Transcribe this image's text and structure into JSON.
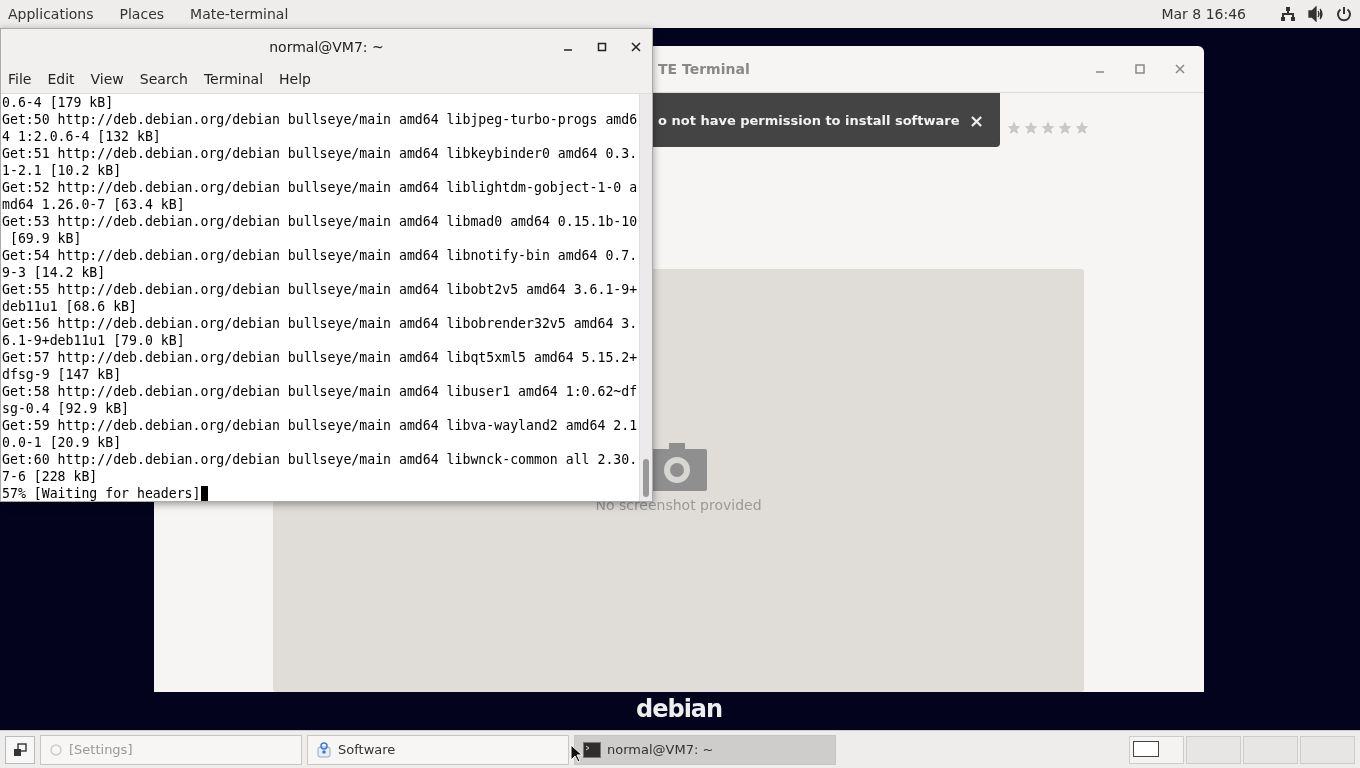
{
  "top_panel": {
    "menus": [
      "Applications",
      "Places",
      "Mate-terminal"
    ],
    "clock": "Mar 8 16:46"
  },
  "wallpaper": {
    "logo": "debian"
  },
  "software_window": {
    "title": "TE Terminal",
    "toast": "o not have permission to install software",
    "toast_close": "×",
    "stars": 0,
    "screenshot_caption": "No screenshot provided"
  },
  "terminal_window": {
    "title": "normal@VM7: ~",
    "menu": [
      "File",
      "Edit",
      "View",
      "Search",
      "Terminal",
      "Help"
    ],
    "lines": [
      "0.6-4 [179 kB]",
      "Get:50 http://deb.debian.org/debian bullseye/main amd64 libjpeg-turbo-progs amd6",
      "4 1:2.0.6-4 [132 kB]",
      "Get:51 http://deb.debian.org/debian bullseye/main amd64 libkeybinder0 amd64 0.3.",
      "1-2.1 [10.2 kB]",
      "Get:52 http://deb.debian.org/debian bullseye/main amd64 liblightdm-gobject-1-0 a",
      "md64 1.26.0-7 [63.4 kB]",
      "Get:53 http://deb.debian.org/debian bullseye/main amd64 libmad0 amd64 0.15.1b-10",
      " [69.9 kB]",
      "Get:54 http://deb.debian.org/debian bullseye/main amd64 libnotify-bin amd64 0.7.",
      "9-3 [14.2 kB]",
      "Get:55 http://deb.debian.org/debian bullseye/main amd64 libobt2v5 amd64 3.6.1-9+",
      "deb11u1 [68.6 kB]",
      "Get:56 http://deb.debian.org/debian bullseye/main amd64 libobrender32v5 amd64 3.",
      "6.1-9+deb11u1 [79.0 kB]",
      "Get:57 http://deb.debian.org/debian bullseye/main amd64 libqt5xml5 amd64 5.15.2+",
      "dfsg-9 [147 kB]",
      "Get:58 http://deb.debian.org/debian bullseye/main amd64 libuser1 amd64 1:0.62~df",
      "sg-0.4 [92.9 kB]",
      "Get:59 http://deb.debian.org/debian bullseye/main amd64 libva-wayland2 amd64 2.1",
      "0.0-1 [20.9 kB]",
      "Get:60 http://deb.debian.org/debian bullseye/main amd64 libwnck-common all 2.30.",
      "7-6 [228 kB]",
      "57% [Waiting for headers]"
    ]
  },
  "taskbar": {
    "items": [
      {
        "kind": "settings",
        "label": "[Settings]",
        "selected": false
      },
      {
        "kind": "software",
        "label": "Software",
        "selected": false
      },
      {
        "kind": "terminal",
        "label": "normal@VM7: ~",
        "selected": true
      }
    ],
    "workspaces": [
      {
        "selected": true
      },
      {
        "selected": false
      },
      {
        "selected": false
      },
      {
        "selected": false
      }
    ]
  }
}
